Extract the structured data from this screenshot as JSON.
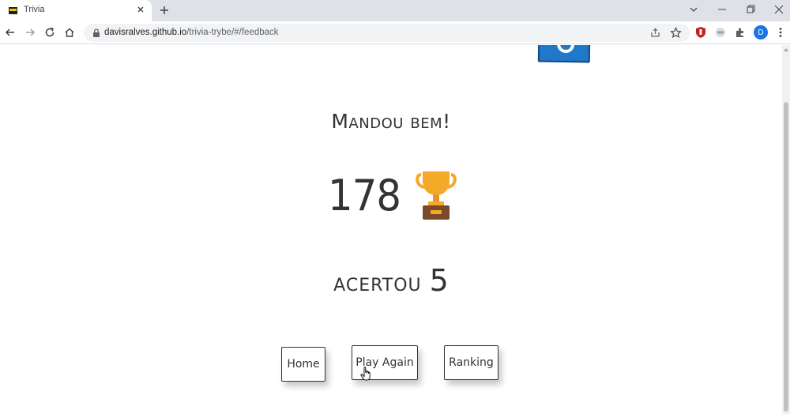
{
  "browser": {
    "tab_title": "Trivia",
    "url_host": "davisralves.github.io",
    "url_path": "/trivia-trybe/#/feedback",
    "profile_initial": "D"
  },
  "page": {
    "feedback_text": "Mandou bem!",
    "score": "178",
    "assertions_label": "acertou",
    "assertions_value": "5",
    "buttons": {
      "home": "Home",
      "play_again": "Play Again",
      "ranking": "Ranking"
    }
  },
  "colors": {
    "text": "#333333",
    "trophy_gold": "#f4a929",
    "trophy_base": "#7b4a2c",
    "logo_blue": "#1f78c8"
  }
}
